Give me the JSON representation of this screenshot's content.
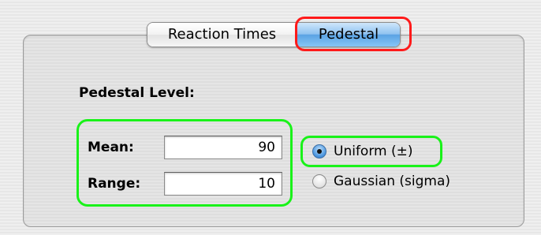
{
  "tabs": [
    {
      "label": "Reaction Times",
      "selected": false
    },
    {
      "label": "Pedestal",
      "selected": true
    }
  ],
  "pedestal": {
    "heading": "Pedestal Level:",
    "mean_label": "Mean:",
    "mean_value": "90",
    "range_label": "Range:",
    "range_value": "10"
  },
  "distribution": {
    "options": [
      {
        "label": "Uniform (±)",
        "selected": true
      },
      {
        "label": "Gaussian (sigma)",
        "selected": false
      }
    ]
  },
  "colors": {
    "selected_tab": "#5aa2e3",
    "red_highlight": "#ff1a1a",
    "green_highlight": "#19f219"
  }
}
